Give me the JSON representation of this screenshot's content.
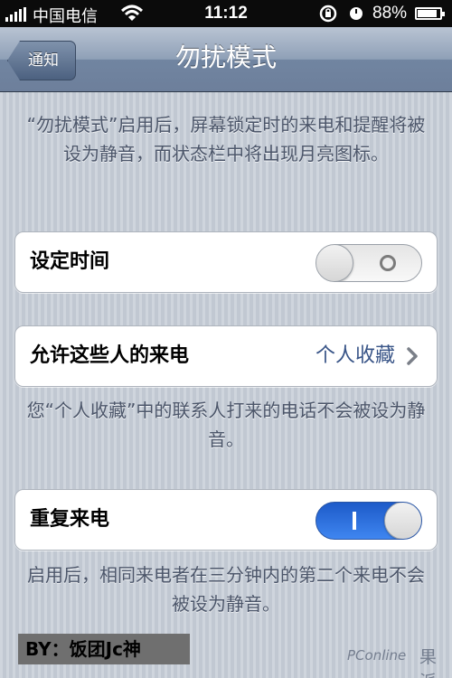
{
  "status_bar": {
    "carrier": "中国电信",
    "time": "11:12",
    "battery": "88%",
    "battery_level": 0.88,
    "icons": [
      "signal-icon",
      "wifi-icon",
      "orientation-lock-icon",
      "clock-icon",
      "battery-icon"
    ]
  },
  "nav": {
    "back_label": "通知",
    "title": "勿扰模式"
  },
  "intro_text": "“勿扰模式”启用后，屏幕锁定时的来电和提醒将被设为静音，而状态栏中将出现月亮图标。",
  "schedule": {
    "label": "设定时间",
    "toggle_state": "off"
  },
  "allow_calls": {
    "label": "允许这些人的来电",
    "value": "个人收藏",
    "footer": "您“个人收藏”中的联系人打来的电话不会被设为静音。"
  },
  "repeated_calls": {
    "label": "重复来电",
    "toggle_state": "on",
    "footer": "启用后，相同来电者在三分钟内的第二个来电不会被设为静音。"
  },
  "watermarks": {
    "by": "BY：饭团Jc神",
    "site": "PConline",
    "brand": "果派"
  },
  "colors": {
    "nav_gradient_top": "#b9c4d3",
    "nav_gradient_bottom": "#6d7f9b",
    "value_text": "#385487",
    "toggle_on": "#2f73e0",
    "background": "#c5ccd6"
  }
}
